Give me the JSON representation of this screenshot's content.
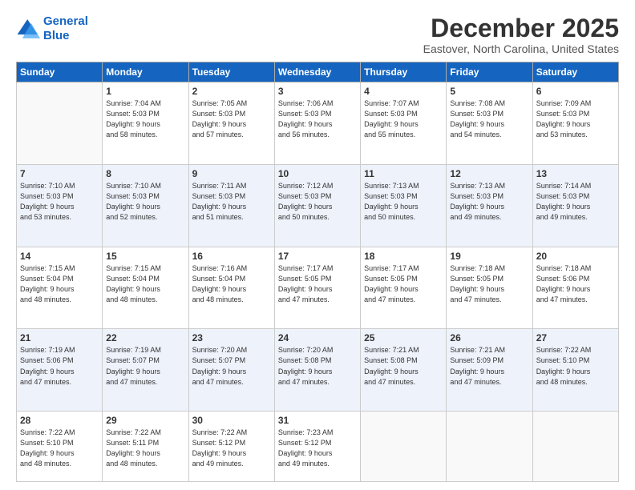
{
  "logo": {
    "line1": "General",
    "line2": "Blue"
  },
  "title": "December 2025",
  "location": "Eastover, North Carolina, United States",
  "days_of_week": [
    "Sunday",
    "Monday",
    "Tuesday",
    "Wednesday",
    "Thursday",
    "Friday",
    "Saturday"
  ],
  "weeks": [
    [
      {
        "day": "",
        "info": ""
      },
      {
        "day": "1",
        "info": "Sunrise: 7:04 AM\nSunset: 5:03 PM\nDaylight: 9 hours\nand 58 minutes."
      },
      {
        "day": "2",
        "info": "Sunrise: 7:05 AM\nSunset: 5:03 PM\nDaylight: 9 hours\nand 57 minutes."
      },
      {
        "day": "3",
        "info": "Sunrise: 7:06 AM\nSunset: 5:03 PM\nDaylight: 9 hours\nand 56 minutes."
      },
      {
        "day": "4",
        "info": "Sunrise: 7:07 AM\nSunset: 5:03 PM\nDaylight: 9 hours\nand 55 minutes."
      },
      {
        "day": "5",
        "info": "Sunrise: 7:08 AM\nSunset: 5:03 PM\nDaylight: 9 hours\nand 54 minutes."
      },
      {
        "day": "6",
        "info": "Sunrise: 7:09 AM\nSunset: 5:03 PM\nDaylight: 9 hours\nand 53 minutes."
      }
    ],
    [
      {
        "day": "7",
        "info": "Sunrise: 7:10 AM\nSunset: 5:03 PM\nDaylight: 9 hours\nand 53 minutes."
      },
      {
        "day": "8",
        "info": "Sunrise: 7:10 AM\nSunset: 5:03 PM\nDaylight: 9 hours\nand 52 minutes."
      },
      {
        "day": "9",
        "info": "Sunrise: 7:11 AM\nSunset: 5:03 PM\nDaylight: 9 hours\nand 51 minutes."
      },
      {
        "day": "10",
        "info": "Sunrise: 7:12 AM\nSunset: 5:03 PM\nDaylight: 9 hours\nand 50 minutes."
      },
      {
        "day": "11",
        "info": "Sunrise: 7:13 AM\nSunset: 5:03 PM\nDaylight: 9 hours\nand 50 minutes."
      },
      {
        "day": "12",
        "info": "Sunrise: 7:13 AM\nSunset: 5:03 PM\nDaylight: 9 hours\nand 49 minutes."
      },
      {
        "day": "13",
        "info": "Sunrise: 7:14 AM\nSunset: 5:03 PM\nDaylight: 9 hours\nand 49 minutes."
      }
    ],
    [
      {
        "day": "14",
        "info": "Sunrise: 7:15 AM\nSunset: 5:04 PM\nDaylight: 9 hours\nand 48 minutes."
      },
      {
        "day": "15",
        "info": "Sunrise: 7:15 AM\nSunset: 5:04 PM\nDaylight: 9 hours\nand 48 minutes."
      },
      {
        "day": "16",
        "info": "Sunrise: 7:16 AM\nSunset: 5:04 PM\nDaylight: 9 hours\nand 48 minutes."
      },
      {
        "day": "17",
        "info": "Sunrise: 7:17 AM\nSunset: 5:05 PM\nDaylight: 9 hours\nand 47 minutes."
      },
      {
        "day": "18",
        "info": "Sunrise: 7:17 AM\nSunset: 5:05 PM\nDaylight: 9 hours\nand 47 minutes."
      },
      {
        "day": "19",
        "info": "Sunrise: 7:18 AM\nSunset: 5:05 PM\nDaylight: 9 hours\nand 47 minutes."
      },
      {
        "day": "20",
        "info": "Sunrise: 7:18 AM\nSunset: 5:06 PM\nDaylight: 9 hours\nand 47 minutes."
      }
    ],
    [
      {
        "day": "21",
        "info": "Sunrise: 7:19 AM\nSunset: 5:06 PM\nDaylight: 9 hours\nand 47 minutes."
      },
      {
        "day": "22",
        "info": "Sunrise: 7:19 AM\nSunset: 5:07 PM\nDaylight: 9 hours\nand 47 minutes."
      },
      {
        "day": "23",
        "info": "Sunrise: 7:20 AM\nSunset: 5:07 PM\nDaylight: 9 hours\nand 47 minutes."
      },
      {
        "day": "24",
        "info": "Sunrise: 7:20 AM\nSunset: 5:08 PM\nDaylight: 9 hours\nand 47 minutes."
      },
      {
        "day": "25",
        "info": "Sunrise: 7:21 AM\nSunset: 5:08 PM\nDaylight: 9 hours\nand 47 minutes."
      },
      {
        "day": "26",
        "info": "Sunrise: 7:21 AM\nSunset: 5:09 PM\nDaylight: 9 hours\nand 47 minutes."
      },
      {
        "day": "27",
        "info": "Sunrise: 7:22 AM\nSunset: 5:10 PM\nDaylight: 9 hours\nand 48 minutes."
      }
    ],
    [
      {
        "day": "28",
        "info": "Sunrise: 7:22 AM\nSunset: 5:10 PM\nDaylight: 9 hours\nand 48 minutes."
      },
      {
        "day": "29",
        "info": "Sunrise: 7:22 AM\nSunset: 5:11 PM\nDaylight: 9 hours\nand 48 minutes."
      },
      {
        "day": "30",
        "info": "Sunrise: 7:22 AM\nSunset: 5:12 PM\nDaylight: 9 hours\nand 49 minutes."
      },
      {
        "day": "31",
        "info": "Sunrise: 7:23 AM\nSunset: 5:12 PM\nDaylight: 9 hours\nand 49 minutes."
      },
      {
        "day": "",
        "info": ""
      },
      {
        "day": "",
        "info": ""
      },
      {
        "day": "",
        "info": ""
      }
    ]
  ]
}
